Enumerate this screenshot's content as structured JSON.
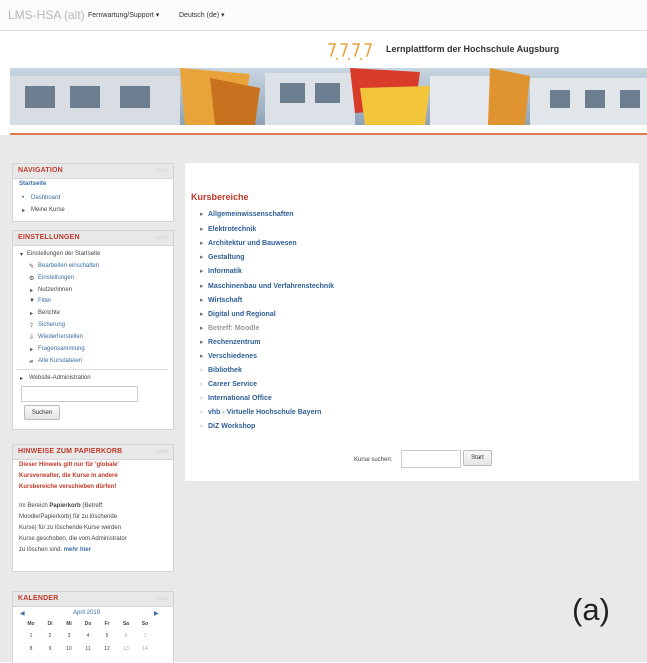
{
  "topbar": {
    "brand": "LMS-HSA (alt)",
    "menu_support": "Fernwartung/Support",
    "menu_language": "Deutsch (de)",
    "caret": "▾"
  },
  "header": {
    "site_name": "Lernplattform der Hochschule Augsburg",
    "accent_color": "#e07a4a"
  },
  "navigation": {
    "title": "NAVIGATION",
    "home": "Startseite",
    "items": [
      {
        "bullet": "•",
        "label": "Dashboard"
      },
      {
        "bullet": "▸",
        "label": "Meine Kurse"
      }
    ]
  },
  "settings": {
    "title": "EINSTELLUNGEN",
    "root": "Einstellungen der Startseite",
    "items": [
      {
        "icon": "pencil-icon",
        "glyph": "✎",
        "label": "Bearbeiten einschalten"
      },
      {
        "icon": "gear-icon",
        "glyph": "⚙",
        "label": "Einstellungen"
      },
      {
        "icon": "chevron-right-icon",
        "glyph": "▸",
        "label": "Nutzer/innen"
      },
      {
        "icon": "filter-icon",
        "glyph": "▼",
        "label": "Filter"
      },
      {
        "icon": "chevron-right-icon",
        "glyph": "▸",
        "label": "Berichte"
      },
      {
        "icon": "backup-icon",
        "glyph": "⇪",
        "label": "Sicherung"
      },
      {
        "icon": "restore-icon",
        "glyph": "⇩",
        "label": "Wiederherstellen"
      },
      {
        "icon": "chevron-right-icon",
        "glyph": "▸",
        "label": "Fragensammlung"
      },
      {
        "icon": "folder-icon",
        "glyph": "▰",
        "label": "Alte Kursdateien"
      }
    ],
    "admin": "Website-Administration",
    "search_button": "Suchen"
  },
  "notice": {
    "title": "HINWEISE ZUM PAPIERKORB",
    "warning_lines": [
      "Dieser Hinweis gilt nur für 'globale'",
      "Kursverwalter, die Kurse in andere",
      "Kursbereiche verschieben dürfen!"
    ],
    "body_line1_prefix": "Im Bereich ",
    "body_line1_bold": "Papierkorb",
    "body_line1_suffix": " (Betreff:",
    "body_lines": [
      "Moodle/Papierkorb) für zu löschende",
      "Kurse) für zu löschende Kurse werden",
      "Kurse geschoben, die vom Administrator"
    ],
    "last_line_text": "zu löschen sind.",
    "last_line_link": "mehr hier"
  },
  "calendar": {
    "title": "KALENDER",
    "month": "April 2019",
    "prev": "◀",
    "next": "▶",
    "weekdays": [
      "Mo",
      "Di",
      "Mi",
      "Do",
      "Fr",
      "Sa",
      "So"
    ],
    "days": [
      "1",
      "2",
      "3",
      "4",
      "5",
      "6",
      "7",
      "8",
      "9",
      "10",
      "11",
      "12",
      "13",
      "14"
    ]
  },
  "main": {
    "section_title": "Kursbereiche",
    "categories": [
      {
        "label": "Allgemeinwissenschaften",
        "state": "normal"
      },
      {
        "label": "Elektrotechnik",
        "state": "normal"
      },
      {
        "label": "Architektur und Bauwesen",
        "state": "normal"
      },
      {
        "label": "Gestaltung",
        "state": "normal"
      },
      {
        "label": "Informatik",
        "state": "normal"
      },
      {
        "label": "Maschinenbau und Verfahrenstechnik",
        "state": "normal"
      },
      {
        "label": "Wirtschaft",
        "state": "normal"
      },
      {
        "label": "Digital und Regional",
        "state": "normal"
      },
      {
        "label": "Betreff: Moodle",
        "state": "dimmed"
      },
      {
        "label": "Rechenzentrum",
        "state": "normal"
      },
      {
        "label": "Verschiedenes",
        "state": "normal"
      },
      {
        "label": "Bibliothek",
        "state": "empty"
      },
      {
        "label": "Career Service",
        "state": "empty"
      },
      {
        "label": "International Office",
        "state": "empty"
      },
      {
        "label": "vhb - Virtuelle Hochschule Bayern",
        "state": "empty"
      },
      {
        "label": "DiZ Workshop",
        "state": "empty"
      }
    ],
    "search_label": "Kurse suchen:",
    "start_button": "Start"
  },
  "figure_label": "(a)"
}
